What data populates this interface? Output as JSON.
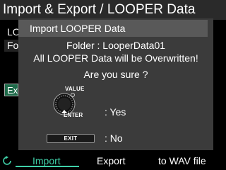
{
  "screen": {
    "title": "Import & Export / LOOPER Data"
  },
  "background": {
    "row1_label": "LO",
    "row2_label": "Fo",
    "button_label": "Ex"
  },
  "dialog": {
    "title": "Import LOOPER Data",
    "folder_line": "Folder : LooperData01",
    "warning_line": "All LOOPER Data will be Overwritten!",
    "question": "Are you sure ?",
    "value_label": "VALUE",
    "enter_label": "ENTER",
    "yes_text": ": Yes",
    "exit_label": "EXIT",
    "no_text": ": No"
  },
  "bottom_tabs": {
    "import": "Import",
    "export": "Export",
    "to_wav": "to WAV file"
  },
  "colors": {
    "accent": "#3fd0a8",
    "dialog_bg": "#3b3b3b",
    "dialog_header_bg": "#595959"
  },
  "icons": {
    "refresh": "refresh-icon",
    "knob": "value-knob-icon"
  }
}
